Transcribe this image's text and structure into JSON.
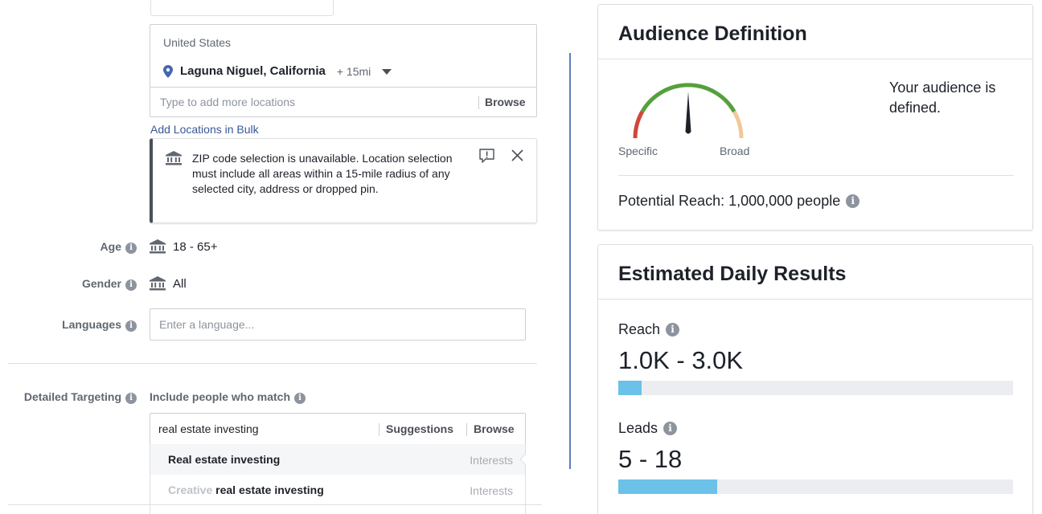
{
  "locations": {
    "country": "United States",
    "city": "Laguna Niguel, California",
    "radius": "+ 15mi",
    "input_placeholder": "Type to add more locations",
    "browse_label": "Browse",
    "bulk_link": "Add Locations in Bulk"
  },
  "notice": {
    "text": "ZIP code selection is unavailable. Location selection must include all areas within a 15-mile radius of any selected city, address or dropped pin."
  },
  "age": {
    "label": "Age",
    "value": "18 - 65+"
  },
  "gender": {
    "label": "Gender",
    "value": "All"
  },
  "languages": {
    "label": "Languages",
    "placeholder": "Enter a language..."
  },
  "detailed_targeting": {
    "label": "Detailed Targeting",
    "include_label": "Include people who match",
    "query": "real estate investing",
    "suggestions_label": "Suggestions",
    "browse_label": "Browse",
    "results": [
      {
        "prefix": "",
        "name": "Real estate investing",
        "type": "Interests"
      },
      {
        "prefix": "Creative",
        "name": "real estate investing",
        "type": "Interests"
      }
    ]
  },
  "audience_definition": {
    "title": "Audience Definition",
    "specific_label": "Specific",
    "broad_label": "Broad",
    "status": "Your audience is defined.",
    "potential_reach": "Potential Reach: 1,000,000 people",
    "colors": {
      "low": "#d0463b",
      "mid": "#56a03c",
      "high": "#f2c89a",
      "needle": "#1d2129"
    }
  },
  "estimated_daily_results": {
    "title": "Estimated Daily Results",
    "metrics": [
      {
        "label": "Reach",
        "value": "1.0K - 3.0K",
        "fill_fraction": 0.06
      },
      {
        "label": "Leads",
        "value": "5 - 18",
        "fill_fraction": 0.25
      }
    ],
    "bar_color": "#6bc1e8"
  }
}
